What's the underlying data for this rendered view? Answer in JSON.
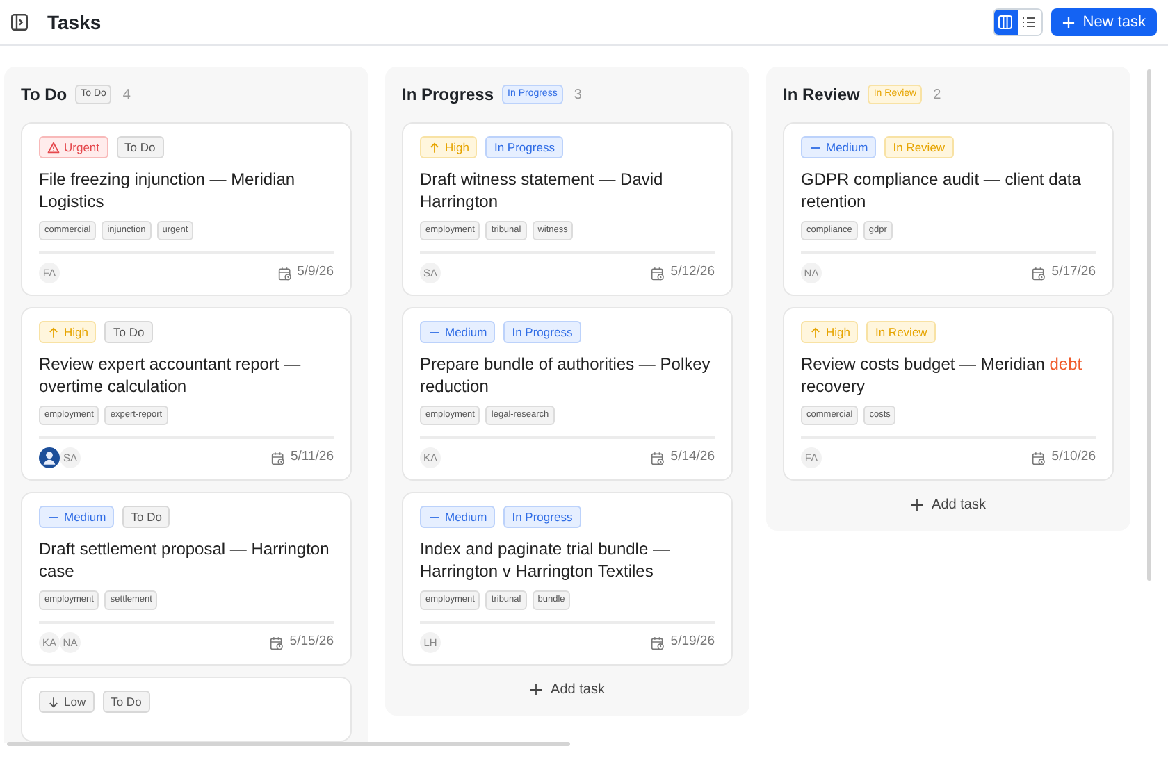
{
  "header": {
    "title": "Tasks",
    "views": [
      {
        "kind": "board",
        "selected": true
      },
      {
        "kind": "list",
        "selected": false
      }
    ],
    "new_button": "New task"
  },
  "columns": [
    {
      "title": "To Do",
      "badge": {
        "kind": "todo",
        "label": "To Do"
      },
      "count": "4",
      "cards": [
        {
          "priority": {
            "kind": "urgent",
            "label": "Urgent"
          },
          "status": {
            "kind": "todo",
            "label": "To Do"
          },
          "title_parts": [
            {
              "text": "File freezing injunction — Meridian Logistics",
              "highlighted": false
            }
          ],
          "tags": [
            "commercial",
            "injunction",
            "urgent"
          ],
          "assignees": [
            {
              "kind": "initials",
              "text": "FA"
            }
          ],
          "due": "5/9/26"
        },
        {
          "priority": {
            "kind": "high",
            "label": "High"
          },
          "status": {
            "kind": "todo",
            "label": "To Do"
          },
          "title_parts": [
            {
              "text": "Review expert accountant report — overtime calculation",
              "highlighted": false
            }
          ],
          "tags": [
            "employment",
            "expert-report"
          ],
          "assignees": [
            {
              "kind": "photo"
            },
            {
              "kind": "initials",
              "text": "SA"
            }
          ],
          "due": "5/11/26"
        },
        {
          "priority": {
            "kind": "medium",
            "label": "Medium"
          },
          "status": {
            "kind": "todo",
            "label": "To Do"
          },
          "title_parts": [
            {
              "text": "Draft settlement proposal — Harrington case",
              "highlighted": false
            }
          ],
          "tags": [
            "employment",
            "settlement"
          ],
          "assignees": [
            {
              "kind": "initials",
              "text": "KA"
            },
            {
              "kind": "initials",
              "text": "NA"
            }
          ],
          "due": "5/15/26"
        },
        {
          "priority": {
            "kind": "low",
            "label": "Low"
          },
          "status": {
            "kind": "todo",
            "label": "To Do"
          }
        }
      ]
    },
    {
      "title": "In Progress",
      "badge": {
        "kind": "progress",
        "label": "In Progress"
      },
      "count": "3",
      "add_task": "Add task",
      "cards": [
        {
          "priority": {
            "kind": "high",
            "label": "High"
          },
          "status": {
            "kind": "progress",
            "label": "In Progress"
          },
          "title_parts": [
            {
              "text": "Draft witness statement — David Harrington",
              "highlighted": false
            }
          ],
          "tags": [
            "employment",
            "tribunal",
            "witness"
          ],
          "assignees": [
            {
              "kind": "initials",
              "text": "SA"
            }
          ],
          "due": "5/12/26"
        },
        {
          "priority": {
            "kind": "medium",
            "label": "Medium"
          },
          "status": {
            "kind": "progress",
            "label": "In Progress"
          },
          "title_parts": [
            {
              "text": "Prepare bundle of authorities — Polkey reduction",
              "highlighted": false
            }
          ],
          "tags": [
            "employment",
            "legal-research"
          ],
          "assignees": [
            {
              "kind": "initials",
              "text": "KA"
            }
          ],
          "due": "5/14/26"
        },
        {
          "priority": {
            "kind": "medium",
            "label": "Medium"
          },
          "status": {
            "kind": "progress",
            "label": "In Progress"
          },
          "title_parts": [
            {
              "text": "Index and paginate trial bundle — Harrington v Harrington Textiles",
              "highlighted": false
            }
          ],
          "tags": [
            "employment",
            "tribunal",
            "bundle"
          ],
          "assignees": [
            {
              "kind": "initials",
              "text": "LH"
            }
          ],
          "due": "5/19/26"
        }
      ]
    },
    {
      "title": "In Review",
      "badge": {
        "kind": "review",
        "label": "In Review"
      },
      "count": "2",
      "add_task": "Add task",
      "cards": [
        {
          "priority": {
            "kind": "medium",
            "label": "Medium"
          },
          "status": {
            "kind": "review",
            "label": "In Review"
          },
          "title_parts": [
            {
              "text": "GDPR compliance audit — client data retention",
              "highlighted": false
            }
          ],
          "tags": [
            "compliance",
            "gdpr"
          ],
          "assignees": [
            {
              "kind": "initials",
              "text": "NA"
            }
          ],
          "due": "5/17/26"
        },
        {
          "priority": {
            "kind": "high",
            "label": "High"
          },
          "status": {
            "kind": "review",
            "label": "In Review"
          },
          "title_parts": [
            {
              "text": "Review costs budget — Meridian ",
              "highlighted": false
            },
            {
              "text": "debt",
              "highlighted": true
            },
            {
              "text": " recovery",
              "highlighted": false
            }
          ],
          "tags": [
            "commercial",
            "costs"
          ],
          "assignees": [
            {
              "kind": "initials",
              "text": "FA"
            }
          ],
          "due": "5/10/26"
        }
      ]
    }
  ]
}
